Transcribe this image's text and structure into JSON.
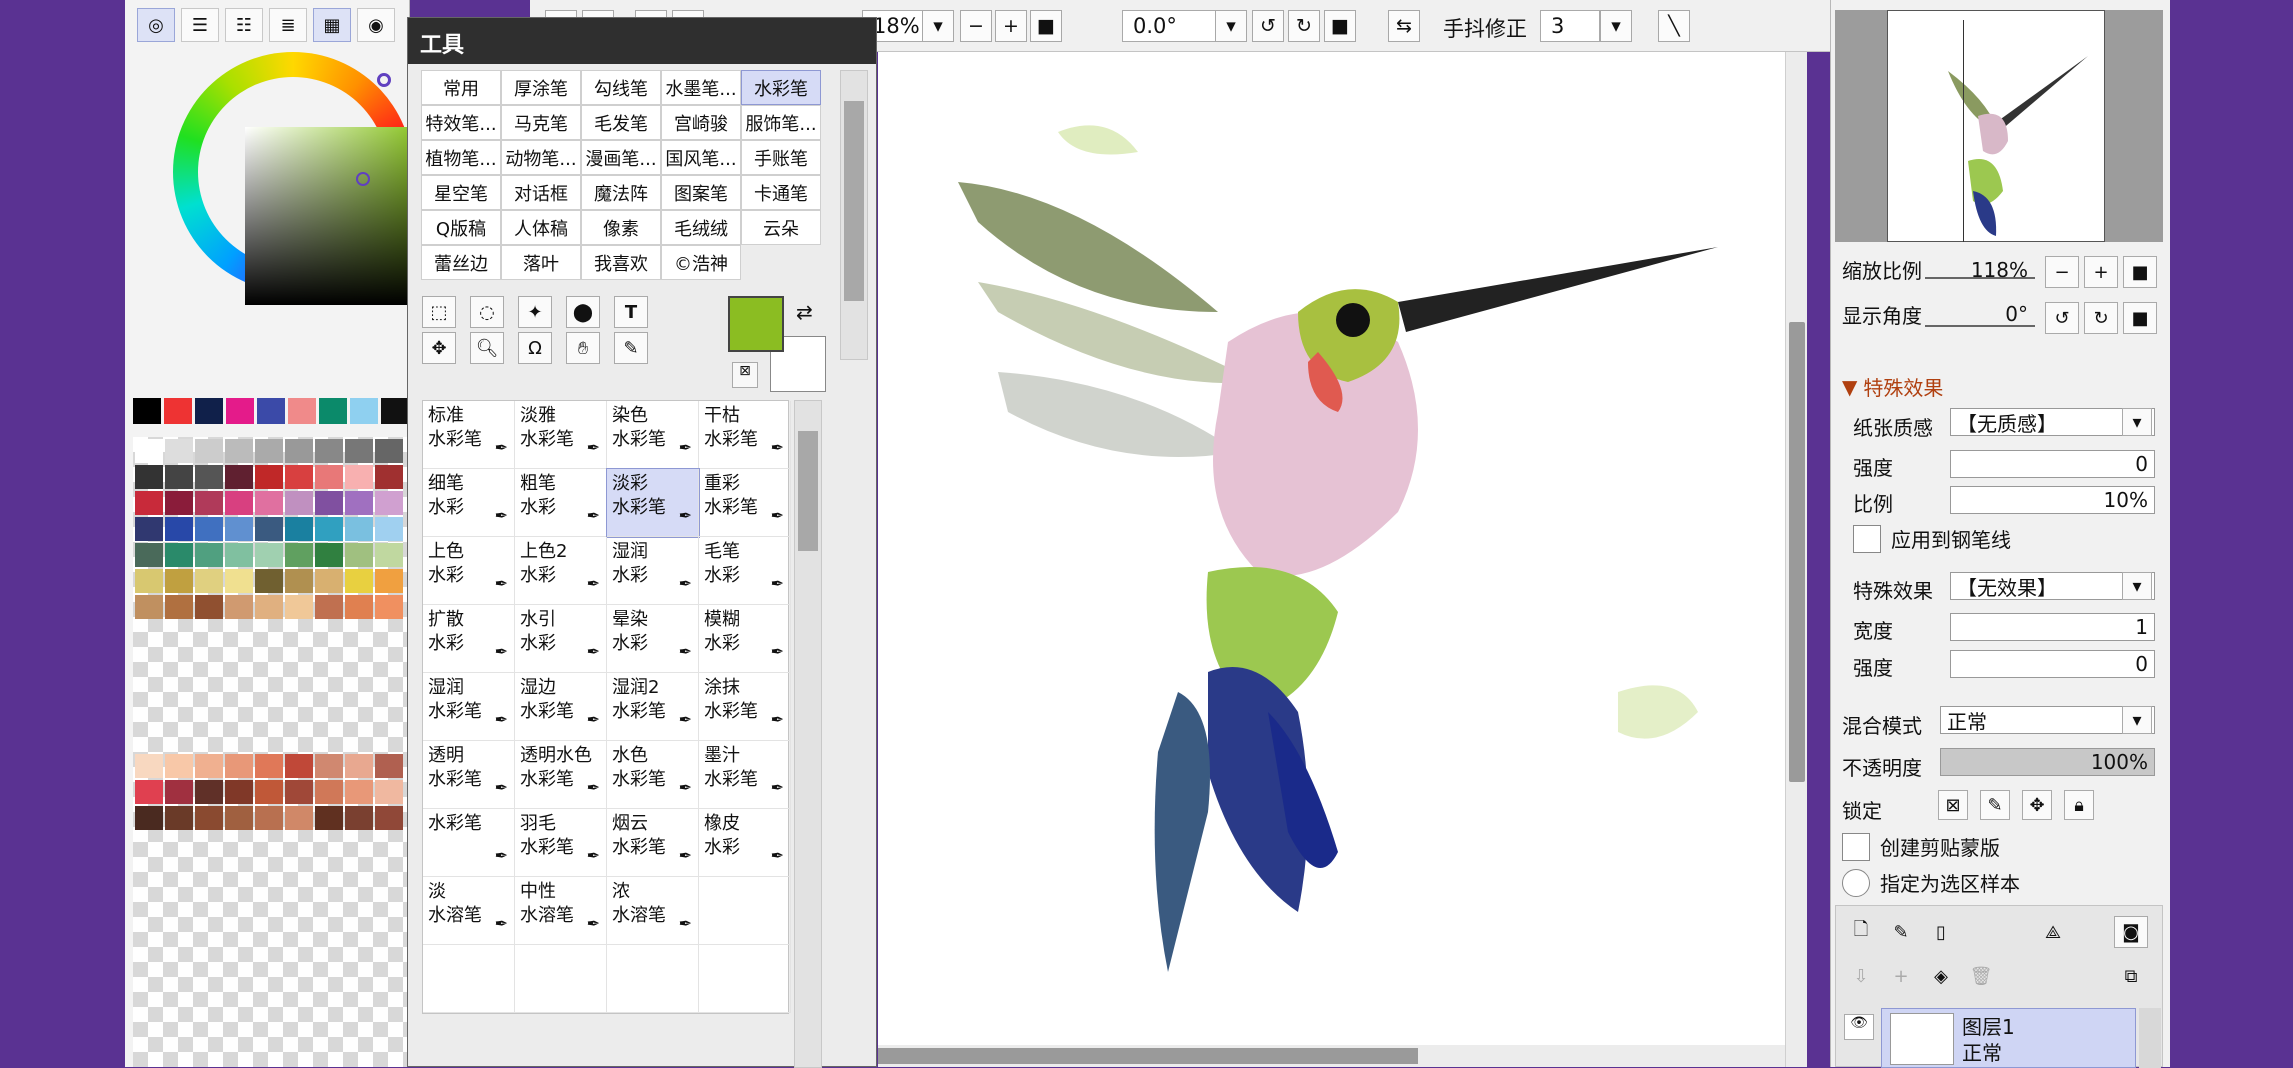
{
  "colors": {
    "accent": "#8bbd22",
    "topbar_bg": "#f0f0f0",
    "panel_bg": "#f3f3f3",
    "desktop": "#5a3292"
  },
  "top_toolbar": {
    "zoom": "18%",
    "angle": "0.0°",
    "stabilizer_label": "手抖修正",
    "stabilizer_value": "3"
  },
  "tools_panel": {
    "title": "工具",
    "categories": [
      "常用",
      "厚涂笔",
      "勾线笔",
      "水墨笔...",
      "水彩笔",
      "特效笔...",
      "马克笔",
      "毛发笔",
      "宫崎骏",
      "服饰笔...",
      "植物笔...",
      "动物笔...",
      "漫画笔...",
      "国风笔...",
      "手账笔",
      "星空笔",
      "对话框",
      "魔法阵",
      "图案笔",
      "卡通笔",
      "Q版稿",
      "人体稿",
      "像素",
      "毛绒绒",
      "云朵",
      "蕾丝边",
      "落叶",
      "我喜欢",
      "©浩神"
    ],
    "selected_category": "水彩笔",
    "brushes": [
      [
        "标准",
        "水彩笔"
      ],
      [
        "淡雅",
        "水彩笔"
      ],
      [
        "染色",
        "水彩笔"
      ],
      [
        "干枯",
        "水彩笔"
      ],
      [
        "细笔",
        "水彩"
      ],
      [
        "粗笔",
        "水彩"
      ],
      [
        "淡彩",
        "水彩笔"
      ],
      [
        "重彩",
        "水彩笔"
      ],
      [
        "上色",
        "水彩"
      ],
      [
        "上色2",
        "水彩"
      ],
      [
        "湿润",
        "水彩"
      ],
      [
        "毛笔",
        "水彩"
      ],
      [
        "扩散",
        "水彩"
      ],
      [
        "水引",
        "水彩"
      ],
      [
        "晕染",
        "水彩"
      ],
      [
        "模糊",
        "水彩"
      ],
      [
        "湿润",
        "水彩笔"
      ],
      [
        "湿边",
        "水彩笔"
      ],
      [
        "湿润2",
        "水彩笔"
      ],
      [
        "涂抹",
        "水彩笔"
      ],
      [
        "透明",
        "水彩笔"
      ],
      [
        "透明水色",
        "水彩笔"
      ],
      [
        "水色",
        "水彩笔"
      ],
      [
        "墨汁",
        "水彩笔"
      ],
      [
        "水彩笔",
        ""
      ],
      [
        "羽毛",
        "水彩笔"
      ],
      [
        "烟云",
        "水彩笔"
      ],
      [
        "橡皮",
        "水彩"
      ],
      [
        "淡",
        "水溶笔"
      ],
      [
        "中性",
        "水溶笔"
      ],
      [
        "浓",
        "水溶笔"
      ]
    ],
    "selected_brush_index": 6
  },
  "navigator": {
    "zoom_label": "缩放比例",
    "zoom_value": "118%",
    "angle_label": "显示角度",
    "angle_value": "0°"
  },
  "effects": {
    "section_title": "特殊效果",
    "paper_label": "纸张质感",
    "paper_value": "【无质感】",
    "strength_label": "强度",
    "strength_value": "0",
    "scale_label": "比例",
    "scale_value": "10%",
    "apply_pen_label": "应用到钢笔线",
    "effect_label": "特殊效果",
    "effect_value": "【无效果】",
    "width_label": "宽度",
    "width_value": "1",
    "strength2_label": "强度",
    "strength2_value": "0"
  },
  "layer": {
    "blend_label": "混合模式",
    "blend_value": "正常",
    "opacity_label": "不透明度",
    "opacity_value": "100%",
    "lock_label": "锁定",
    "clip_label": "创建剪贴蒙版",
    "sample_label": "指定为选区样本",
    "layer_name": "图层1",
    "layer_mode": "正常"
  }
}
